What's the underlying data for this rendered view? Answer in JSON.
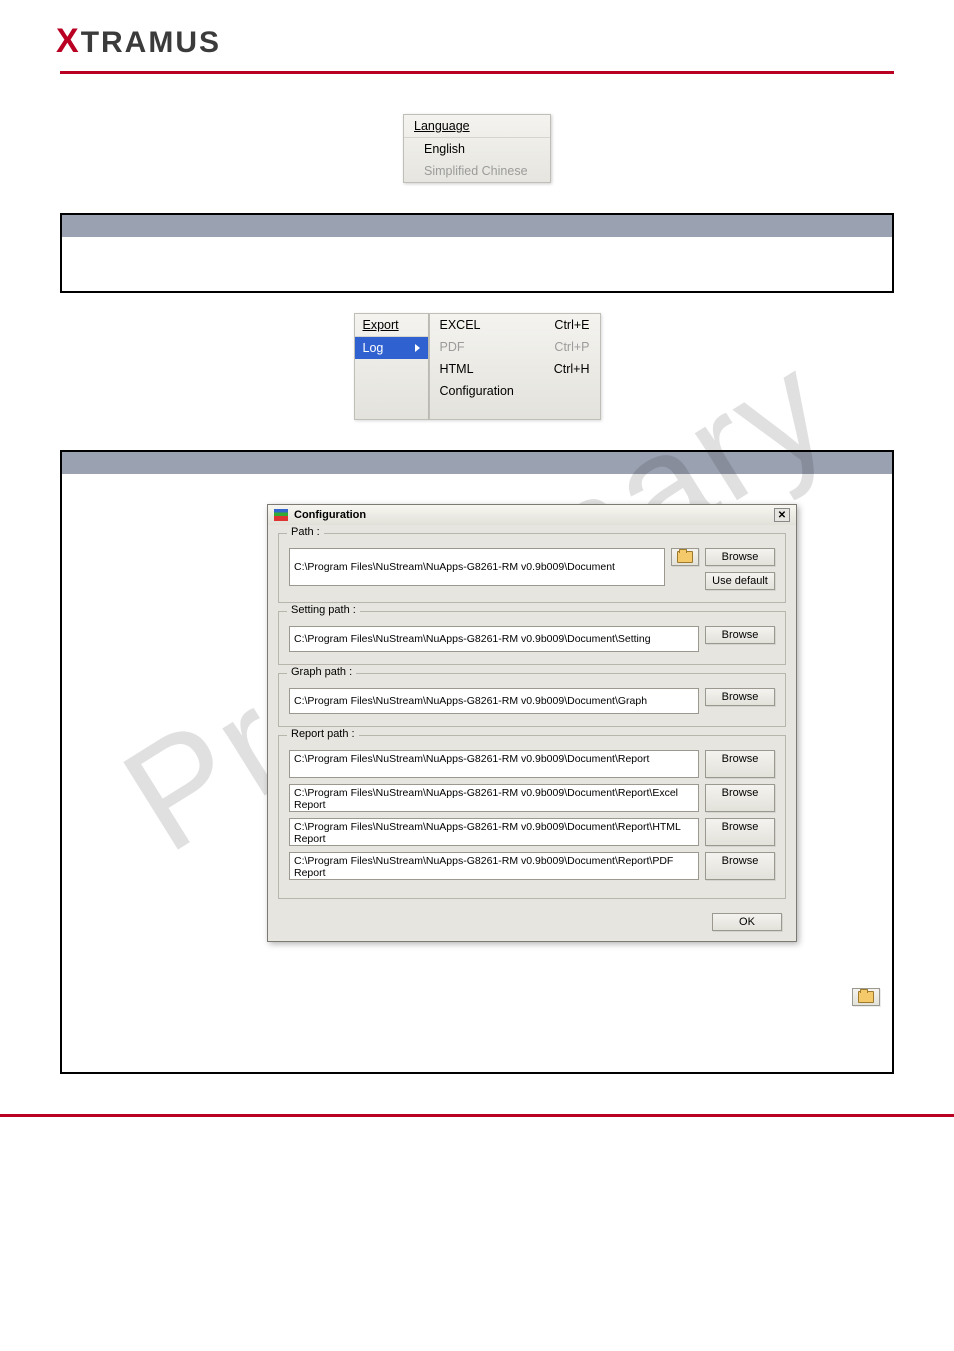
{
  "brand": {
    "prefix": "X",
    "rest": "TRAMUS"
  },
  "watermark": "Preliminary",
  "languageMenu": {
    "header": "Language",
    "items": [
      "English",
      "Simplified Chinese"
    ]
  },
  "exportMenu": {
    "header": "Export",
    "selected": "Log",
    "sub": [
      {
        "label": "EXCEL",
        "shortcut": "Ctrl+E",
        "enabled": true
      },
      {
        "label": "PDF",
        "shortcut": "Ctrl+P",
        "enabled": false
      },
      {
        "label": "HTML",
        "shortcut": "Ctrl+H",
        "enabled": true
      },
      {
        "label": "Configuration",
        "shortcut": "",
        "enabled": true
      }
    ]
  },
  "configDialog": {
    "title": "Configuration",
    "pathGroup": {
      "legend": "Path :",
      "value": "C:\\Program Files\\NuStream\\NuApps-G8261-RM v0.9b009\\Document",
      "browse": "Browse",
      "useDefault": "Use default"
    },
    "settingGroup": {
      "legend": "Setting path :",
      "value": "C:\\Program Files\\NuStream\\NuApps-G8261-RM v0.9b009\\Document\\Setting",
      "browse": "Browse"
    },
    "graphGroup": {
      "legend": "Graph path :",
      "value": "C:\\Program Files\\NuStream\\NuApps-G8261-RM v0.9b009\\Document\\Graph",
      "browse": "Browse"
    },
    "reportGroup": {
      "legend": "Report path :",
      "rows": [
        {
          "value": "C:\\Program Files\\NuStream\\NuApps-G8261-RM v0.9b009\\Document\\Report",
          "browse": "Browse"
        },
        {
          "value": "C:\\Program Files\\NuStream\\NuApps-G8261-RM v0.9b009\\Document\\Report\\Excel Report",
          "browse": "Browse"
        },
        {
          "value": "C:\\Program Files\\NuStream\\NuApps-G8261-RM v0.9b009\\Document\\Report\\HTML Report",
          "browse": "Browse"
        },
        {
          "value": "C:\\Program Files\\NuStream\\NuApps-G8261-RM v0.9b009\\Document\\Report\\PDF Report",
          "browse": "Browse"
        }
      ]
    },
    "ok": "OK"
  }
}
